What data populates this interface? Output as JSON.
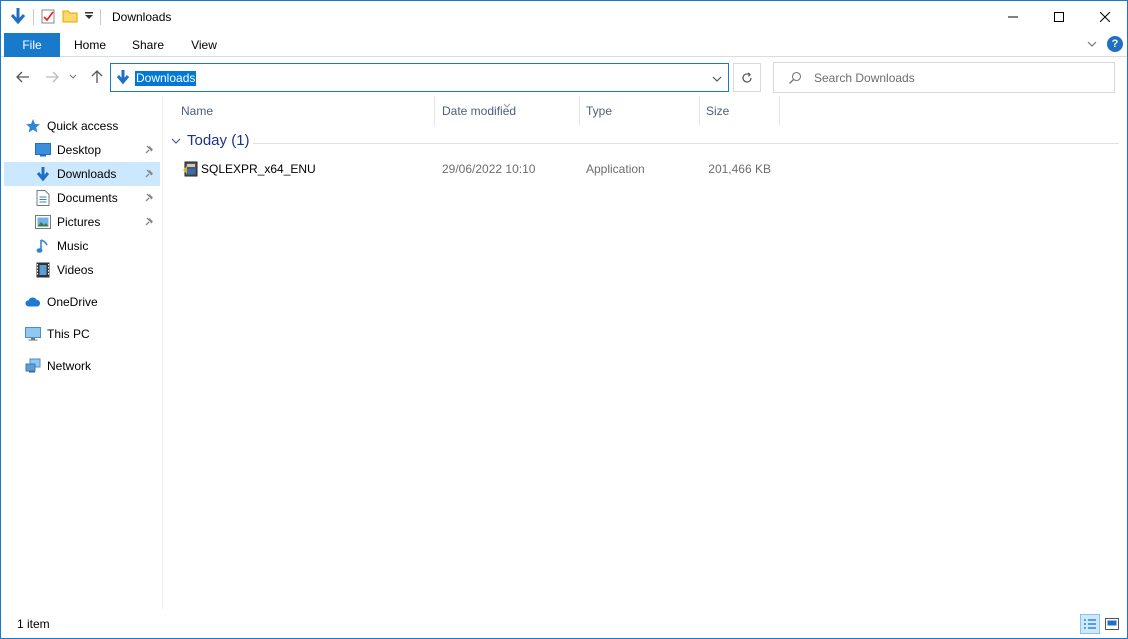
{
  "window": {
    "title": "Downloads"
  },
  "ribbon": {
    "tabs": [
      {
        "label": "File"
      },
      {
        "label": "Home"
      },
      {
        "label": "Share"
      },
      {
        "label": "View"
      }
    ]
  },
  "address": {
    "path": "Downloads"
  },
  "search": {
    "placeholder": "Search Downloads"
  },
  "sidebar": {
    "items": [
      {
        "label": "Quick access",
        "icon": "star-icon"
      },
      {
        "label": "Desktop",
        "icon": "desktop-icon",
        "pinned": true
      },
      {
        "label": "Downloads",
        "icon": "download-arrow-icon",
        "pinned": true,
        "selected": true
      },
      {
        "label": "Documents",
        "icon": "document-icon",
        "pinned": true
      },
      {
        "label": "Pictures",
        "icon": "picture-icon",
        "pinned": true
      },
      {
        "label": "Music",
        "icon": "music-note-icon"
      },
      {
        "label": "Videos",
        "icon": "film-icon"
      },
      {
        "label": "OneDrive",
        "icon": "cloud-icon"
      },
      {
        "label": "This PC",
        "icon": "monitor-icon"
      },
      {
        "label": "Network",
        "icon": "network-icon"
      }
    ]
  },
  "columns": [
    {
      "label": "Name"
    },
    {
      "label": "Date modified"
    },
    {
      "label": "Type"
    },
    {
      "label": "Size"
    }
  ],
  "group": {
    "label": "Today (1)"
  },
  "files": [
    {
      "name": "SQLEXPR_x64_ENU",
      "date_modified": "29/06/2022 10:10",
      "type": "Application",
      "size": "201,466 KB"
    }
  ],
  "status": {
    "item_count": "1 item"
  },
  "colors": {
    "accent": "#1979ca",
    "selection": "#cce8ff",
    "group_text": "#1e3287"
  }
}
